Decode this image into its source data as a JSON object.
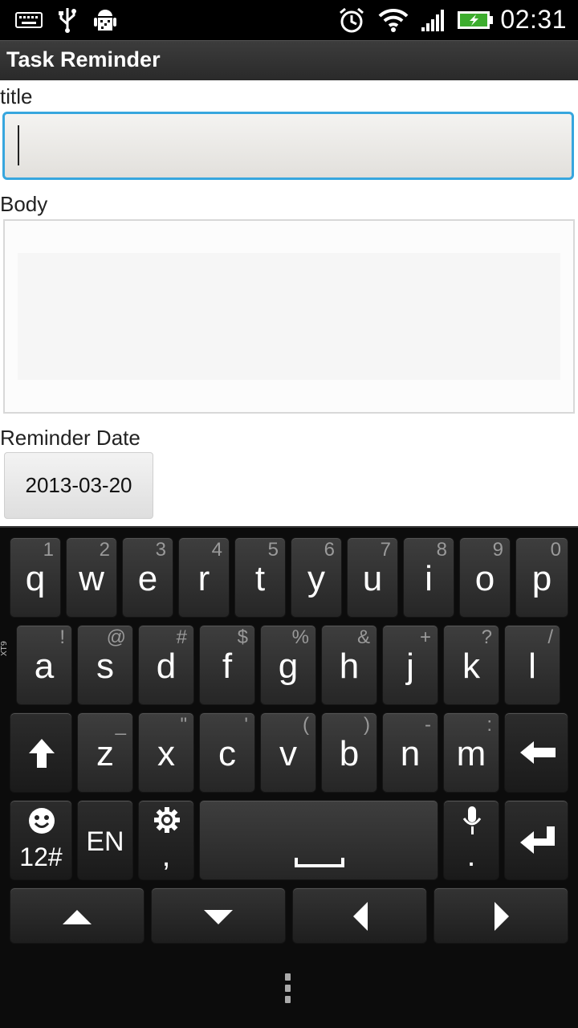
{
  "status_bar": {
    "time": "02:31",
    "left_icons": [
      "keyboard-icon",
      "usb-icon",
      "android-debug-icon"
    ],
    "right_icons": [
      "alarm-icon",
      "wifi-icon",
      "signal-icon",
      "battery-charging-icon"
    ]
  },
  "app": {
    "title": "Task Reminder"
  },
  "form": {
    "title_label": "title",
    "title_value": "",
    "body_label": "Body",
    "body_value": "",
    "date_label": "Reminder Date",
    "date_value": "2013-03-20"
  },
  "keyboard": {
    "side_label": "XT9",
    "row1": [
      {
        "key": "q",
        "hint": "1"
      },
      {
        "key": "w",
        "hint": "2"
      },
      {
        "key": "e",
        "hint": "3"
      },
      {
        "key": "r",
        "hint": "4"
      },
      {
        "key": "t",
        "hint": "5"
      },
      {
        "key": "y",
        "hint": "6"
      },
      {
        "key": "u",
        "hint": "7"
      },
      {
        "key": "i",
        "hint": "8"
      },
      {
        "key": "o",
        "hint": "9"
      },
      {
        "key": "p",
        "hint": "0"
      }
    ],
    "row2": [
      {
        "key": "a",
        "hint": "!"
      },
      {
        "key": "s",
        "hint": "@"
      },
      {
        "key": "d",
        "hint": "#"
      },
      {
        "key": "f",
        "hint": "$"
      },
      {
        "key": "g",
        "hint": "%"
      },
      {
        "key": "h",
        "hint": "&"
      },
      {
        "key": "j",
        "hint": "+"
      },
      {
        "key": "k",
        "hint": "?"
      },
      {
        "key": "l",
        "hint": "/"
      }
    ],
    "row3": [
      {
        "key": "z",
        "hint": "_"
      },
      {
        "key": "x",
        "hint": "\""
      },
      {
        "key": "c",
        "hint": "'"
      },
      {
        "key": "v",
        "hint": "("
      },
      {
        "key": "b",
        "hint": ")"
      },
      {
        "key": "n",
        "hint": "-"
      },
      {
        "key": "m",
        "hint": ":"
      }
    ],
    "shift_icon": "shift-arrow-icon",
    "backspace_icon": "backspace-icon",
    "symbols_label": "12#",
    "emoji_icon": "smiley-icon",
    "language_label": "EN",
    "settings_icon": "gear-icon",
    "comma_label": ",",
    "space_icon": "spacebar-icon",
    "mic_icon": "microphone-icon",
    "period_label": ".",
    "enter_icon": "enter-icon",
    "nav_icons": [
      "arrow-up-icon",
      "arrow-down-icon",
      "arrow-left-icon",
      "arrow-right-icon"
    ],
    "menu_icon": "menu-dots-icon"
  }
}
